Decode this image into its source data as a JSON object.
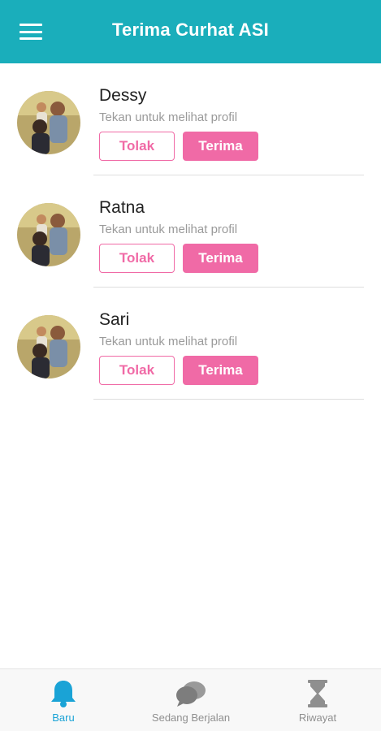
{
  "appbar": {
    "title": "Terima Curhat ASI"
  },
  "requests": [
    {
      "name": "Dessy",
      "hint": "Tekan untuk melihat profil",
      "reject_label": "Tolak",
      "accept_label": "Terima"
    },
    {
      "name": "Ratna",
      "hint": "Tekan untuk melihat profil",
      "reject_label": "Tolak",
      "accept_label": "Terima"
    },
    {
      "name": "Sari",
      "hint": "Tekan untuk melihat profil",
      "reject_label": "Tolak",
      "accept_label": "Terima"
    }
  ],
  "bottom_nav": [
    {
      "label": "Baru",
      "icon": "bell-icon",
      "active": true
    },
    {
      "label": "Sedang Berjalan",
      "icon": "chat-bubbles-icon",
      "active": false
    },
    {
      "label": "Riwayat",
      "icon": "hourglass-icon",
      "active": false
    }
  ],
  "colors": {
    "primary": "#1aaebb",
    "accent_pink": "#f06aa6",
    "nav_active": "#1aa3d6",
    "nav_inactive": "#8f8f8f"
  }
}
